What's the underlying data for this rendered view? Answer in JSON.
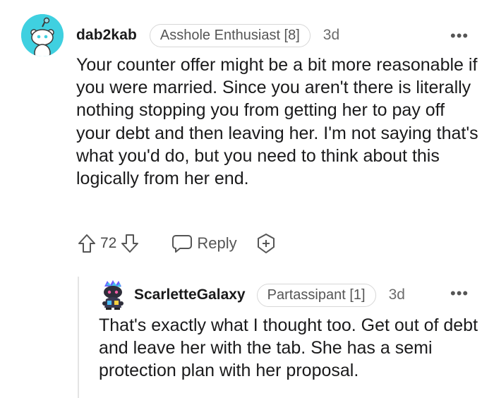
{
  "main_comment": {
    "username": "dab2kab",
    "flair": "Asshole Enthusiast [8]",
    "age": "3d",
    "more_label": "•••",
    "avatar_icon": "reddit-snoo-avatar-icon",
    "avatar_color": "#3fd0e0",
    "body": "Your counter offer might be a bit more reasonable if you were married. Since you aren't there is literally nothing stopping you from getting her to pay off your debt and then leaving her. I'm not saying that's what you'd do, but you need to think about this logically from her end.",
    "score": "72",
    "reply_label": "Reply",
    "upvote_icon": "upvote-arrow-icon",
    "downvote_icon": "downvote-arrow-icon",
    "reply_icon": "speech-bubble-icon",
    "award_icon": "award-plus-icon"
  },
  "reply_comment": {
    "username": "ScarletteGalaxy",
    "flair": "Partassipant [1]",
    "age": "3d",
    "more_label": "•••",
    "avatar_icon": "custom-snoo-avatar-icon",
    "body": "That's exactly what I thought too. Get out of debt and leave her with the tab. She has a semi protection plan with her proposal."
  }
}
